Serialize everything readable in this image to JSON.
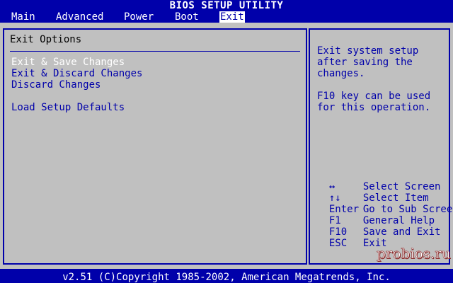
{
  "title": "BIOS SETUP UTILITY",
  "menu": [
    {
      "label": "Main"
    },
    {
      "label": "Advanced"
    },
    {
      "label": "Power"
    },
    {
      "label": "Boot"
    },
    {
      "label": "Exit"
    }
  ],
  "active_menu": "Exit",
  "section": {
    "title": "Exit Options",
    "options": [
      {
        "label": "Exit & Save Changes",
        "selected": true
      },
      {
        "label": "Exit & Discard Changes",
        "selected": false
      },
      {
        "label": "Discard Changes",
        "selected": false
      },
      {
        "label": "Load Setup Defaults",
        "selected": false
      }
    ]
  },
  "help": {
    "lines": [
      "Exit system setup",
      "after saving the",
      "changes.",
      "",
      "F10 key can be used",
      "for this operation."
    ]
  },
  "keys": [
    {
      "key": "↔",
      "desc": "Select Screen"
    },
    {
      "key": "↑↓",
      "desc": "Select Item"
    },
    {
      "key": "Enter",
      "desc": "Go to Sub Screen"
    },
    {
      "key": "F1",
      "desc": "General Help"
    },
    {
      "key": "F10",
      "desc": "Save and Exit"
    },
    {
      "key": "ESC",
      "desc": "Exit"
    }
  ],
  "watermark": "probios.ru",
  "footer": "v2.51 (C)Copyright 1985-2002, American Megatrends, Inc.",
  "colors": {
    "background": "#0000aa",
    "panel": "#c0c0c0",
    "highlight_text": "#ffffff",
    "normal_text": "#0000aa"
  }
}
